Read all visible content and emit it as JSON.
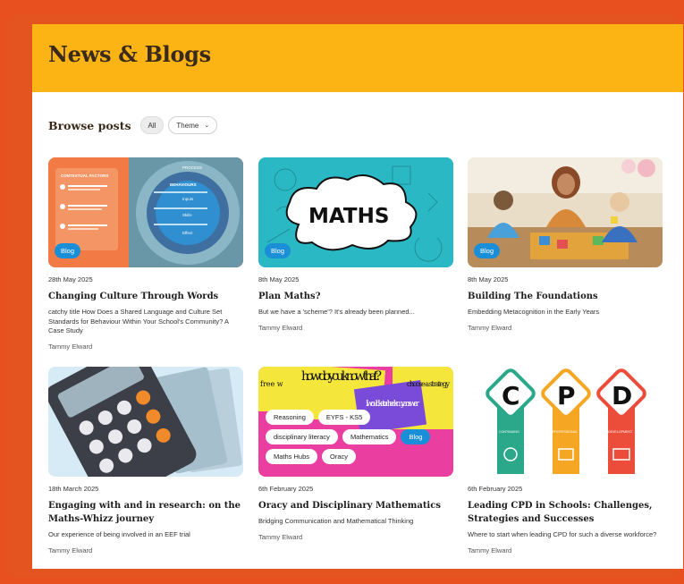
{
  "header": {
    "title": "News & Blogs"
  },
  "browse": {
    "label": "Browse posts",
    "all_label": "All",
    "theme_label": "Theme",
    "theme_chevron": "⌄"
  },
  "colors": {
    "accent": "#fcb314",
    "frame": "#e35420",
    "badge": "#1a8fd8"
  },
  "posts": [
    {
      "badge": "Blog",
      "date": "28th May 2025",
      "title": "Changing Culture Through Words",
      "description": "catchy title How Does a Shared Language and Culture Set Standards for Behaviour Within Your School's Community? A Case Study",
      "author": "Tammy Elward",
      "thumb_labels": {
        "heading": "CONTEXTUAL FACTORS",
        "process": "PROCESS",
        "behaviours": "BEHAVIOURS",
        "inputs": "Inputs",
        "skills": "Skills",
        "effect": "Effect"
      }
    },
    {
      "badge": "Blog",
      "date": "8th May 2025",
      "title": "Plan Maths?",
      "description": "But we have a 'scheme'? It's already been planned...",
      "author": "Tammy Elward",
      "thumb_labels": {
        "word": "MATHS"
      }
    },
    {
      "badge": "Blog",
      "date": "8th May 2025",
      "title": "Building The Foundations",
      "description": "Embedding Metacognition in the Early Years",
      "author": "Tammy Elward"
    },
    {
      "date": "18th March 2025",
      "title": "Engaging with and in research: on the Maths-Whizz journey",
      "description": "Our experience of being involved in an EEF trial",
      "author": "Tammy Elward"
    },
    {
      "date": "6th February 2025",
      "title": "Oracy and Disciplinary Mathematics",
      "description": "Bridging Communication and Mathematical Thinking",
      "author": "Tammy Elward",
      "tags": [
        "Reasoning",
        "EYFS - KS5",
        "disciplinary literacy",
        "Mathematics",
        "Blog",
        "Maths Hubs",
        "Oracy"
      ],
      "thumb_labels": {
        "bubble1": "how do you know that?",
        "bubble2": "I would like to check my answer",
        "bubble3": "choose a strategy",
        "bubble4": "free w"
      }
    },
    {
      "date": "6th February 2025",
      "title": "Leading CPD in Schools: Challenges, Strategies and Successes",
      "description": "Where to start when leading CPD for such a diverse workforce?",
      "author": "Tammy Elward",
      "thumb_labels": {
        "c": "C",
        "p": "P",
        "d": "D",
        "continuing": "CONTINUING",
        "professional": "PROFESSIONAL",
        "development": "DEVELOPMENT"
      }
    }
  ]
}
